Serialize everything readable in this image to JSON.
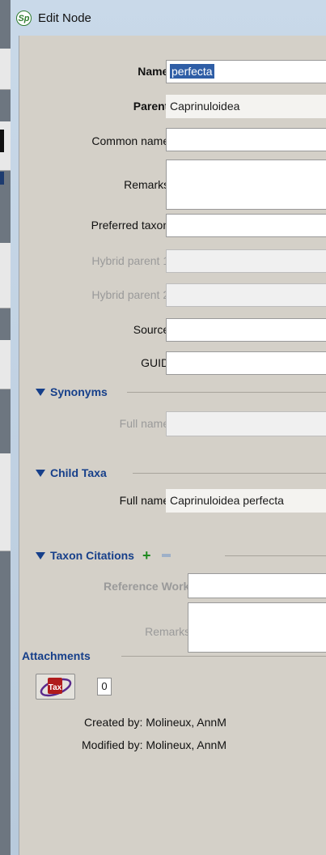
{
  "window": {
    "title": "Edit Node",
    "icon_text": "Sp"
  },
  "fields": {
    "name": {
      "label": "Name:",
      "value": "perfecta"
    },
    "parent": {
      "label": "Parent:",
      "value": "Caprinuloidea"
    },
    "common_name": {
      "label": "Common name:",
      "value": ""
    },
    "remarks": {
      "label": "Remarks:",
      "value": ""
    },
    "preferred_taxon": {
      "label": "Preferred taxon:",
      "value": ""
    },
    "hybrid_parent_1": {
      "label": "Hybrid parent 1:",
      "value": ""
    },
    "hybrid_parent_2": {
      "label": "Hybrid parent 2:",
      "value": ""
    },
    "source": {
      "label": "Source:",
      "value": ""
    },
    "guid": {
      "label": "GUID:",
      "value": ""
    }
  },
  "synonyms": {
    "title": "Synonyms",
    "full_name_label": "Full name:",
    "full_name_value": ""
  },
  "child_taxa": {
    "title": "Child Taxa",
    "full_name_label": "Full name:",
    "full_name_value": "Caprinuloidea perfecta"
  },
  "taxon_citations": {
    "title": "Taxon Citations",
    "add_icon": "+",
    "reference_work_label": "Reference Work:",
    "remarks_label": "Remarks:"
  },
  "attachments": {
    "title": "Attachments",
    "count": "0",
    "icon_text": "Tax"
  },
  "audit": {
    "created_label": "Created by:",
    "created_value": "Molineux, AnnM",
    "modified_label": "Modified by:",
    "modified_value": "Molineux, AnnM"
  },
  "colors": {
    "section": "#163f8a",
    "selection": "#2f5ea6",
    "panel": "#d4d0c8",
    "add": "#1f8a1f"
  }
}
